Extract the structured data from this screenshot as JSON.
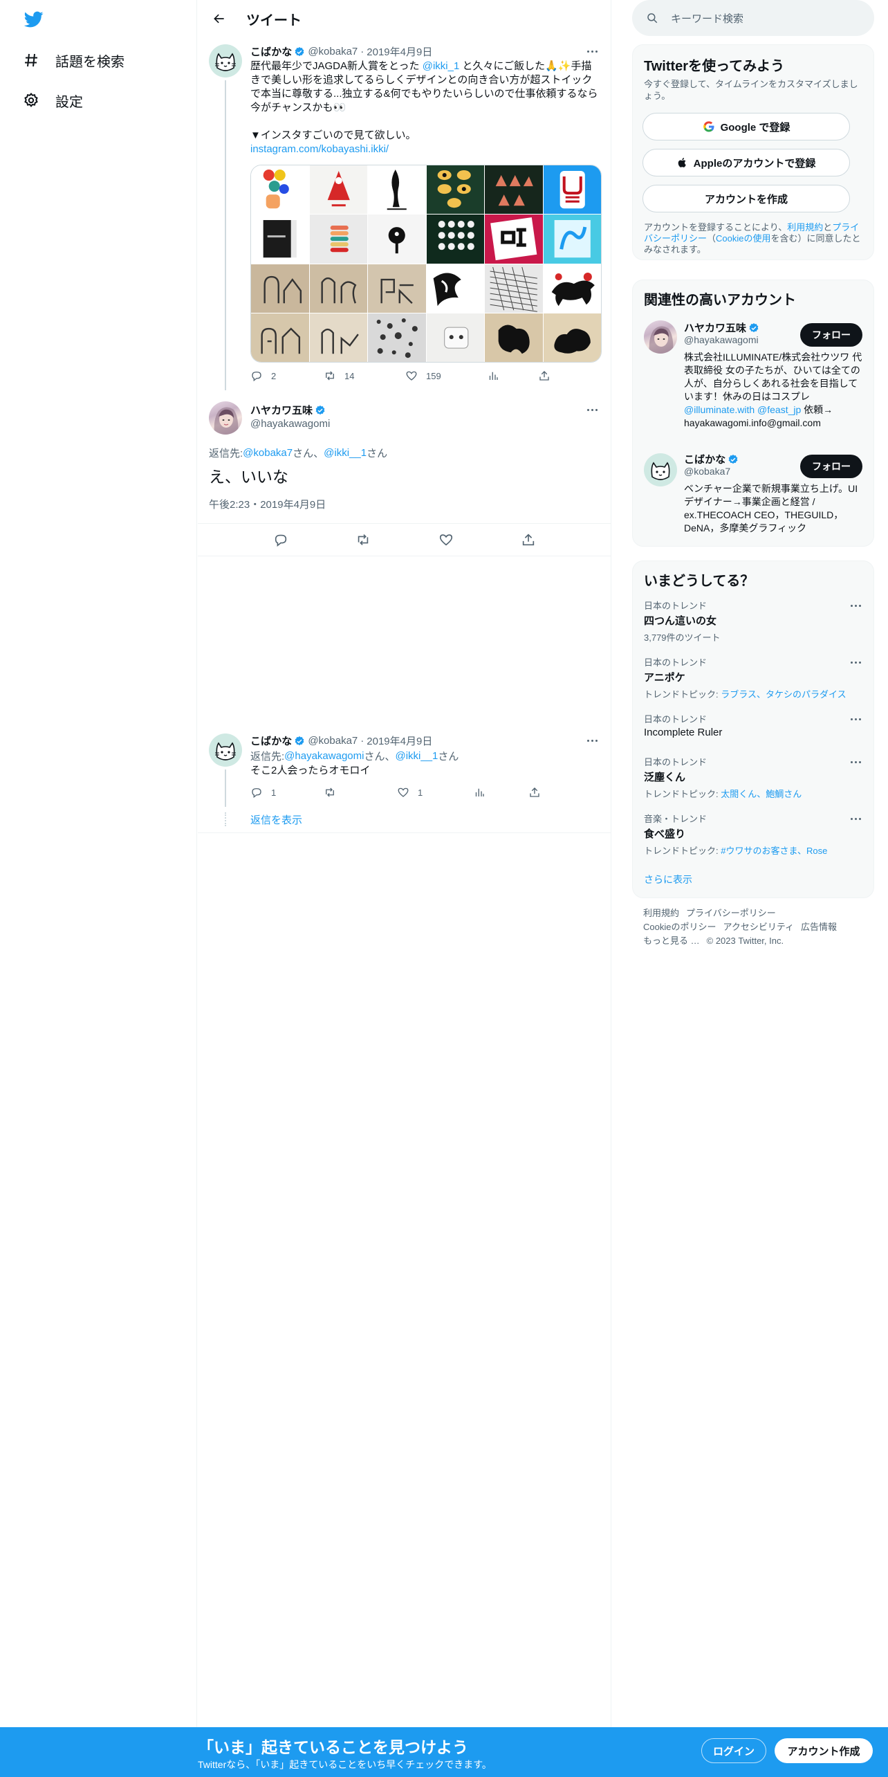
{
  "nav": {
    "explore_label": "話題を検索",
    "settings_label": "設定"
  },
  "header": {
    "title": "ツイート"
  },
  "tweet1": {
    "name": "こばかな",
    "handle": "@kobaka7",
    "date": "2019年4月9日",
    "text_parts": [
      "歴代最年少でJAGDA新人賞をとった ",
      "@ikki_1",
      " と久々にご飯した🙏✨手描\nきで美しい形を追求してるらしくデザインとの向き合い方が超ストイック\nで本当に尊敬する...独立する&何でもやりたいらしいので仕事依頼するなら\n今がチャンスかも👀\n\n▼インスタすごいので見て欲しい。\n",
      "instagram.com/kobayashi.ikki/"
    ],
    "replies": "2",
    "retweets": "14",
    "likes": "159"
  },
  "tweet2": {
    "name": "ハヤカワ五味",
    "handle": "@hayakawagomi",
    "reply_prefix": "返信先: ",
    "reply_to_1": "@kobaka7",
    "reply_mid": "さん、",
    "reply_to_2": "@ikki__1",
    "reply_suffix": "さん",
    "text": "え、いいな",
    "timestamp": "午後2:23・2019年4月9日"
  },
  "tweet3": {
    "name": "こばかな",
    "handle": "@kobaka7",
    "date": "2019年4月9日",
    "reply_prefix": "返信先: ",
    "reply_to_1": "@hayakawagomi",
    "reply_mid": "さん、",
    "reply_to_2": "@ikki__1",
    "reply_suffix": "さん",
    "text": "そこ2人会ったらオモロイ",
    "replies": "1",
    "likes": "1",
    "show_replies": "返信を表示"
  },
  "search": {
    "placeholder": "キーワード検索"
  },
  "signup_card": {
    "title": "Twitterを使ってみよう",
    "subtitle": "今すぐ登録して、タイムラインをカスタマイズしましょう。",
    "google_label": "Google で登録",
    "apple_label": "Appleのアカウントで登録",
    "create_label": "アカウントを作成",
    "terms_prefix": "アカウントを登録することにより、",
    "terms_link": "利用規約",
    "terms_and": "と",
    "privacy_link": "プライバシーポリシー",
    "cookie_open": "（",
    "cookie_link": "Cookieの使用",
    "terms_suffix": "を含む）に同意したとみなされます。"
  },
  "relevant": {
    "title": "関連性の高いアカウント",
    "accounts": [
      {
        "name": "ハヤカワ五味",
        "handle": "@hayakawagomi",
        "follow": "フォロー",
        "bio_1": "株式会社ILLUMINATE/株式会社ウツワ 代表取締役 女の子たちが、ひいては全ての人が、自分らしくあれる社会を目指しています！休みの日はコスプレ ",
        "bio_link_1": "@illuminate.with",
        "bio_link_2": "@feast_jp",
        "bio_2": " 依頼→ hayakawagomi.info@gmail.com"
      },
      {
        "name": "こばかな",
        "handle": "@kobaka7",
        "follow": "フォロー",
        "bio": "ベンチャー企業で新規事業立ち上げ。UIデザイナー→事業企画と経営 / ex.THECOACH CEO，THEGUILD，DeNA，多摩美グラフィック"
      }
    ]
  },
  "trends": {
    "title": "いまどうしてる？",
    "items": [
      {
        "category": "日本のトレンド",
        "name": "四つん這いの女",
        "sub": "3,779件のツイート",
        "topic_prefix": "",
        "topic": ""
      },
      {
        "category": "日本のトレンド",
        "name": "アニポケ",
        "sub": "",
        "topic_prefix": "トレンドトピック: ",
        "topic": "ラブラス、タケシのパラダイス"
      },
      {
        "category": "日本のトレンド",
        "name": "Incomplete Ruler",
        "sub": "",
        "topic_prefix": "",
        "topic": ""
      },
      {
        "category": "日本のトレンド",
        "name": "泛塵くん",
        "sub": "",
        "topic_prefix": "トレンドトピック: ",
        "topic": "太閤くん、鮑鯛さん"
      },
      {
        "category": "音楽・トレンド",
        "name": "食べ盛り",
        "sub": "",
        "topic_prefix": "トレンドトピック: ",
        "topic": "#ウワサのお客さま、Rose"
      }
    ],
    "show_more": "さらに表示"
  },
  "footer": {
    "terms": "利用規約",
    "privacy": "プライバシーポリシー",
    "cookie": "Cookieのポリシー",
    "accessibility": "アクセシビリティ",
    "ads": "広告情報",
    "more": "もっと見る …",
    "copyright": "© 2023 Twitter, Inc."
  },
  "bottom_bar": {
    "title": "「いま」起きていることを見つけよう",
    "subtitle": "Twitterなら、「いま」起きていることをいち早くチェックできます。",
    "login": "ログイン",
    "signup": "アカウント作成"
  },
  "colors": {
    "brand": "#1d9bf0",
    "text": "#0f1419",
    "muted": "#536471",
    "border": "#eff3f4"
  }
}
